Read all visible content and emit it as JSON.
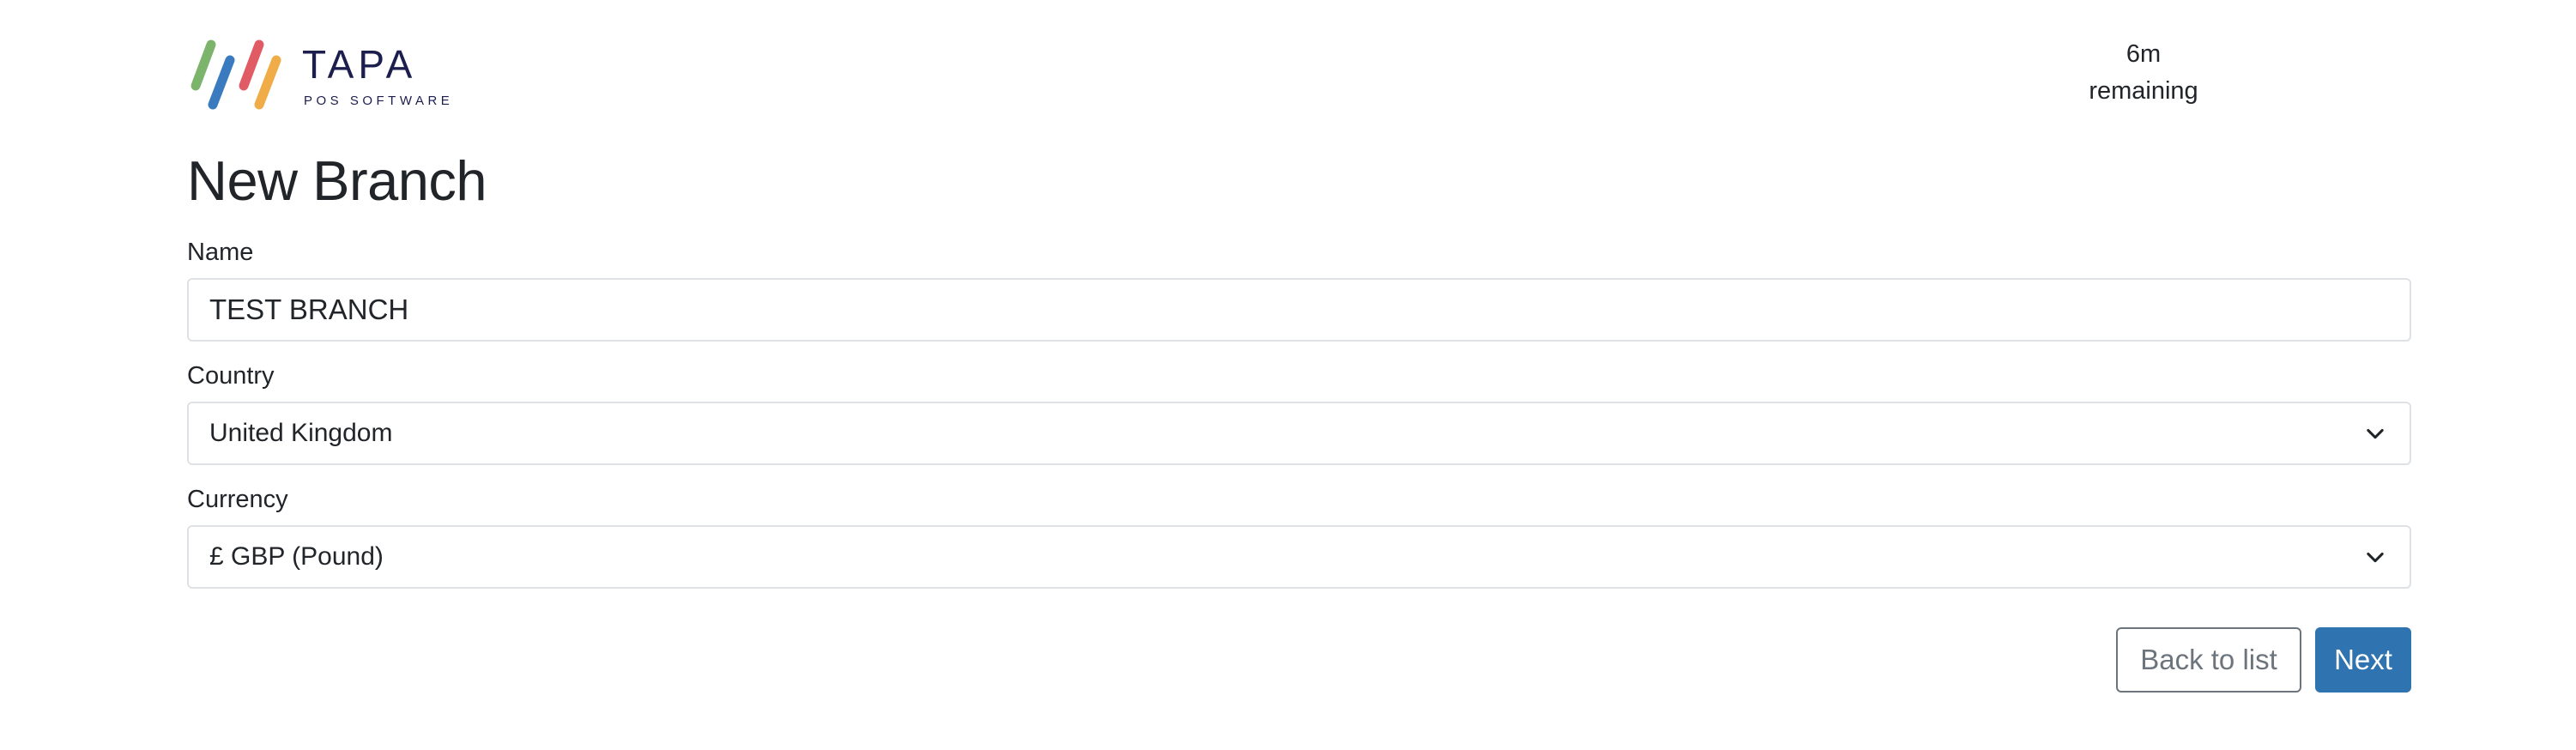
{
  "brand": {
    "name": "TAPA",
    "tagline": "POS SOFTWARE",
    "colors": [
      "#7cb46b",
      "#3a7bbf",
      "#e15b64",
      "#efac47"
    ]
  },
  "timer": {
    "value": "6m",
    "label": "remaining"
  },
  "page_title": "New Branch",
  "form": {
    "name": {
      "label": "Name",
      "value": "TEST BRANCH"
    },
    "country": {
      "label": "Country",
      "value": "United Kingdom"
    },
    "currency": {
      "label": "Currency",
      "value": "£ GBP (Pound)"
    }
  },
  "actions": {
    "back_label": "Back to list",
    "next_label": "Next"
  },
  "colors": {
    "primary": "#2f74b1",
    "secondary": "#6c757d",
    "border": "#dee2e6",
    "text": "#212529"
  }
}
